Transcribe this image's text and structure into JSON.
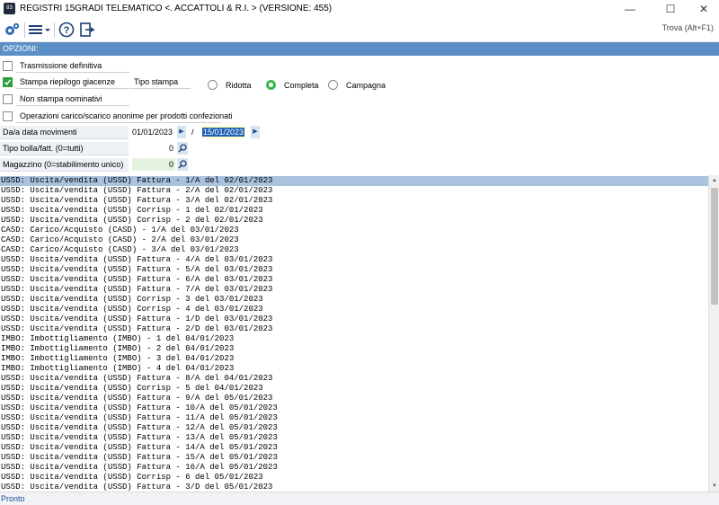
{
  "window": {
    "title": "REGISTRI 15GRADI TELEMATICO <.          ACCATTOLI & R.I.  > (VERSIONE: 455)",
    "app_icon_text": "83"
  },
  "toolbar": {
    "find_label": "Trova (Alt+F1)",
    "icons": [
      "gear-icon",
      "menu-icon",
      "help-icon",
      "exit-icon"
    ]
  },
  "section": {
    "title": "OPZIONI:"
  },
  "options": {
    "trasmissione_definitiva": {
      "label": "Trasmissione definitiva",
      "checked": false
    },
    "stampa_riepilogo": {
      "label": "Stampa riepilogo giacenze",
      "checked": true
    },
    "non_stampa_nominativi": {
      "label": "Non stampa nominativi",
      "checked": false
    },
    "operazioni_anonime": {
      "label": "Operazioni carico/scarico anonime per prodotti confezionati",
      "checked": false
    }
  },
  "tipo_stampa": {
    "label": "Tipo stampa",
    "options": [
      "Ridotta",
      "Completa",
      "Campagna"
    ],
    "selected": "Completa"
  },
  "fields": {
    "date_range": {
      "label": "Da/a data movimenti",
      "from": "01/01/2023",
      "separator": "/",
      "to": "15/01/2023"
    },
    "tipo_bolla": {
      "label": "Tipo bolla/fatt. (0=tutti)",
      "value": "0"
    },
    "magazzino": {
      "label": "Magazzino (0=stabilimento unico)",
      "value": "0"
    }
  },
  "list": {
    "selected_index": 0,
    "rows": [
      "USSD: Uscita/vendita (USSD) Fattura - 1/A del 02/01/2023",
      "USSD: Uscita/vendita (USSD) Fattura - 2/A del 02/01/2023",
      "USSD: Uscita/vendita (USSD) Fattura - 3/A del 02/01/2023",
      "USSD: Uscita/vendita (USSD) Corrisp - 1 del 02/01/2023",
      "USSD: Uscita/vendita (USSD) Corrisp - 2 del 02/01/2023",
      "CASD: Carico/Acquisto (CASD) - 1/A del 03/01/2023",
      "CASD: Carico/Acquisto (CASD) - 2/A del 03/01/2023",
      "CASD: Carico/Acquisto (CASD) - 3/A del 03/01/2023",
      "USSD: Uscita/vendita (USSD) Fattura - 4/A del 03/01/2023",
      "USSD: Uscita/vendita (USSD) Fattura - 5/A del 03/01/2023",
      "USSD: Uscita/vendita (USSD) Fattura - 6/A del 03/01/2023",
      "USSD: Uscita/vendita (USSD) Fattura - 7/A del 03/01/2023",
      "USSD: Uscita/vendita (USSD) Corrisp - 3 del 03/01/2023",
      "USSD: Uscita/vendita (USSD) Corrisp - 4 del 03/01/2023",
      "USSD: Uscita/vendita (USSD) Fattura - 1/D del 03/01/2023",
      "USSD: Uscita/vendita (USSD) Fattura - 2/D del 03/01/2023",
      "IMBO: Imbottigliamento (IMBO) - 1 del 04/01/2023",
      "IMBO: Imbottigliamento (IMBO) - 2 del 04/01/2023",
      "IMBO: Imbottigliamento (IMBO) - 3 del 04/01/2023",
      "IMBO: Imbottigliamento (IMBO) - 4 del 04/01/2023",
      "USSD: Uscita/vendita (USSD) Fattura - 8/A del 04/01/2023",
      "USSD: Uscita/vendita (USSD) Corrisp - 5 del 04/01/2023",
      "USSD: Uscita/vendita (USSD) Fattura - 9/A del 05/01/2023",
      "USSD: Uscita/vendita (USSD) Fattura - 10/A del 05/01/2023",
      "USSD: Uscita/vendita (USSD) Fattura - 11/A del 05/01/2023",
      "USSD: Uscita/vendita (USSD) Fattura - 12/A del 05/01/2023",
      "USSD: Uscita/vendita (USSD) Fattura - 13/A del 05/01/2023",
      "USSD: Uscita/vendita (USSD) Fattura - 14/A del 05/01/2023",
      "USSD: Uscita/vendita (USSD) Fattura - 15/A del 05/01/2023",
      "USSD: Uscita/vendita (USSD) Fattura - 16/A del 05/01/2023",
      "USSD: Uscita/vendita (USSD) Corrisp - 6 del 05/01/2023",
      "USSD: Uscita/vendita (USSD) Fattura - 3/D del 05/01/2023"
    ]
  },
  "status": {
    "text": "Pronto"
  }
}
